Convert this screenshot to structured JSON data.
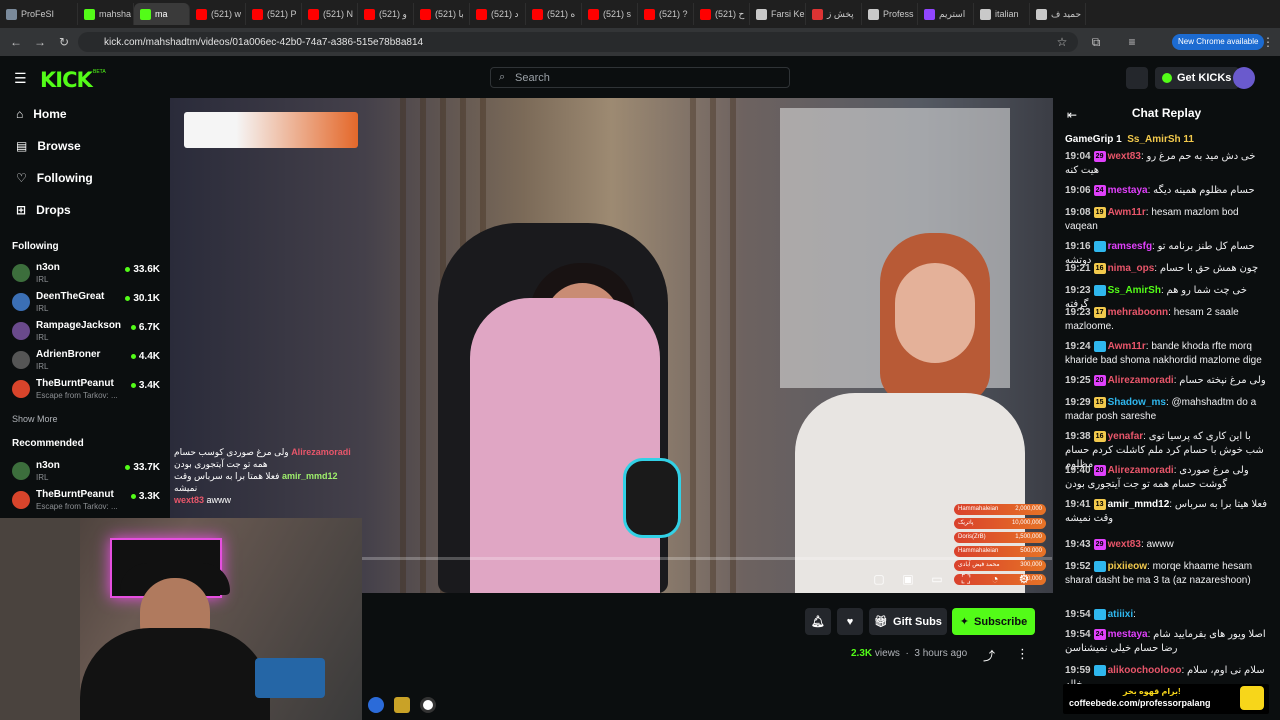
{
  "browser": {
    "tabs": [
      {
        "label": "ProFeSI",
        "color": "#7a8a9b"
      },
      {
        "label": "mahsha",
        "color": "#53fc18"
      },
      {
        "label": "ma",
        "color": "#53fc18",
        "active": true
      },
      {
        "label": "(521) w",
        "color": "#ff0000"
      },
      {
        "label": "(521) P",
        "color": "#ff0000"
      },
      {
        "label": "(521) N",
        "color": "#ff0000"
      },
      {
        "label": "(521) و",
        "color": "#ff0000"
      },
      {
        "label": "(521) با",
        "color": "#ff0000"
      },
      {
        "label": "(521) د",
        "color": "#ff0000"
      },
      {
        "label": "(521) ه",
        "color": "#ff0000"
      },
      {
        "label": "(521) s",
        "color": "#ff0000"
      },
      {
        "label": "(521) ?",
        "color": "#ff0000"
      },
      {
        "label": "(521) ح",
        "color": "#ff0000"
      },
      {
        "label": "Farsi Ke",
        "color": "#c9c9c9"
      },
      {
        "label": "پخش ز",
        "color": "#d33"
      },
      {
        "label": "Profess",
        "color": "#c9c9c9"
      },
      {
        "label": "استریم",
        "color": "#9146ff"
      },
      {
        "label": "italian",
        "color": "#c9c9c9"
      },
      {
        "label": "حمید ف",
        "color": "#c9c9c9"
      }
    ],
    "url": "kick.com/mahshadtm/videos/01a006ec-42b0-74a7-a386-515e78b8a814",
    "new_chrome": "New Chrome available"
  },
  "header": {
    "logo": "KICK",
    "logo_badge": "BETA",
    "search_placeholder": "Search",
    "get_kicks": "Get KICKs"
  },
  "sidebar": {
    "nav": [
      {
        "label": "Home",
        "icon": "home-icon"
      },
      {
        "label": "Browse",
        "icon": "browse-icon"
      },
      {
        "label": "Following",
        "icon": "heart-icon"
      },
      {
        "label": "Drops",
        "icon": "drops-icon"
      }
    ],
    "following_title": "Following",
    "following": [
      {
        "name": "n3on",
        "category": "IRL",
        "viewers": "33.6K",
        "color": "#3c6e3c"
      },
      {
        "name": "DeenTheGreat",
        "category": "IRL",
        "viewers": "30.1K",
        "color": "#3b6fb5"
      },
      {
        "name": "RampageJackson",
        "category": "IRL",
        "viewers": "6.7K",
        "color": "#6a4a8c"
      },
      {
        "name": "AdrienBroner",
        "category": "IRL",
        "viewers": "4.4K",
        "color": "#555555"
      },
      {
        "name": "TheBurntPeanut",
        "category": "Escape from Tarkov: ...",
        "viewers": "3.4K",
        "color": "#d8442b"
      }
    ],
    "show_more": "Show More",
    "recommended_title": "Recommended",
    "recommended": [
      {
        "name": "n3on",
        "category": "IRL",
        "viewers": "33.7K",
        "color": "#3c6e3c"
      },
      {
        "name": "TheBurntPeanut",
        "category": "Escape from Tarkov: ...",
        "viewers": "3.3K",
        "color": "#d8442b"
      }
    ]
  },
  "video": {
    "overlay_chat": [
      {
        "user": "Alirezamoradi",
        "text": "ولی مرغ صوردی کوسب حسام",
        "user_color": "red"
      },
      {
        "user": "",
        "text": "همه تو جت آیتجوری بودن",
        "user_color": ""
      },
      {
        "user": "amir_mmd12",
        "text": "فعلا همتا برا به سرباس وقت",
        "user_color": "green"
      },
      {
        "user": "",
        "text": "نمیشه",
        "user_color": ""
      },
      {
        "user": "wext83",
        "text": "awww",
        "user_color": "red"
      }
    ],
    "donations": [
      {
        "name": "Hammahaleian",
        "amount": "2,000,000"
      },
      {
        "name": "پاتریک",
        "amount": "10,000,000"
      },
      {
        "name": "Doris(ZrB)",
        "amount": "1,500,000"
      },
      {
        "name": "Hammahaleian",
        "amount": "500,000"
      },
      {
        "name": "محمد فیض آبادی",
        "amount": "300,000"
      },
      {
        "name": "",
        "amount": "300,000"
      }
    ]
  },
  "actions": {
    "gift_subs": "Gift Subs",
    "subscribe": "Subscribe",
    "views": "2.3K",
    "views_label": "views",
    "time_ago": "3 hours ago"
  },
  "chat": {
    "title": "Chat Replay",
    "gifters": [
      "GameGrip 1",
      "Ss_AmirSh 11"
    ],
    "messages": [
      {
        "time": "19:04",
        "badge": "29",
        "badge_color": "#e040fb",
        "user": "wext83",
        "user_color": "#e8566a",
        "text": "خی دش مید به حم مرغ رو هیت کنه"
      },
      {
        "time": "19:06",
        "badge": "24",
        "badge_color": "#e040fb",
        "user": "mestaya",
        "user_color": "#e040fb",
        "text": "حسام مظلوم همینه دیگه"
      },
      {
        "time": "19:08",
        "badge": "19",
        "badge_color": "#f2c94c",
        "user": "Awm11r",
        "user_color": "#e8566a",
        "text": "hesam mazlom bod vaqean"
      },
      {
        "time": "19:16",
        "badge": "",
        "badge_color": "",
        "user": "ramsesfg",
        "user_color": "#e040fb",
        "text": "حسام کل طنز برنامه تو دوتشه"
      },
      {
        "time": "19:21",
        "badge": "16",
        "badge_color": "#f2c94c",
        "user": "nima_ops",
        "user_color": "#e8566a",
        "text": "چون همش حق با حسام"
      },
      {
        "time": "19:23",
        "badge": "",
        "badge_color": "",
        "user": "Ss_AmirSh",
        "user_color": "#53fc18",
        "text": "خی چت شما رو هم گرفته"
      },
      {
        "time": "19:23",
        "badge": "17",
        "badge_color": "#f2c94c",
        "user": "mehraboonn",
        "user_color": "#e8566a",
        "text": "hesam 2 saale mazloome."
      },
      {
        "time": "19:24",
        "badge": "",
        "badge_color": "",
        "user": "Awm11r",
        "user_color": "#e8566a",
        "text": "bande khoda rfte morq kharide bad shoma nakhordid mazlome dige"
      },
      {
        "time": "19:25",
        "badge": "20",
        "badge_color": "#e040fb",
        "user": "Alirezamoradi",
        "user_color": "#e8566a",
        "text": "ولی مرغ نپخته حسام"
      },
      {
        "time": "19:29",
        "badge": "15",
        "badge_color": "#f2c94c",
        "user": "Shadow_ms",
        "user_color": "#2fb7ee",
        "text": "@mahshadtm do a madar posh sareshe"
      },
      {
        "time": "19:38",
        "badge": "16",
        "badge_color": "#f2c94c",
        "user": "yenafar",
        "user_color": "#e8566a",
        "text": "با این کاری که پرسیا توی شب خوش با حسام کرد ملم کاشلت کردم حسام مظلوم"
      },
      {
        "time": "19:40",
        "badge": "20",
        "badge_color": "#e040fb",
        "user": "Alirezamoradi",
        "user_color": "#e8566a",
        "text": "ولی مرغ صوردی گوشت حسام همه تو جت آیتجوری بودن"
      },
      {
        "time": "19:41",
        "badge": "13",
        "badge_color": "#f2c94c",
        "user": "amir_mmd12",
        "user_color": "#ffffff",
        "text": "فعلا هیتا برا به سرباس وقت نمیشه"
      },
      {
        "time": "19:43",
        "badge": "29",
        "badge_color": "#e040fb",
        "user": "wext83",
        "user_color": "#e8566a",
        "text": "awww"
      },
      {
        "time": "19:52",
        "badge": "",
        "badge_color": "",
        "user": "pixiieow",
        "user_color": "#f2c94c",
        "text": "morqe khaame hesam sharaf dasht be ma 3 ta (az nazareshoon)"
      },
      {
        "time": "19:54",
        "badge": "",
        "badge_color": "",
        "user": "atiiixi",
        "user_color": "#2fb7ee",
        "text": ""
      },
      {
        "time": "19:54",
        "badge": "24",
        "badge_color": "#e040fb",
        "user": "mestaya",
        "user_color": "#e040fb",
        "text": "اصلا ویور های بفرمایید شام رضا حسام خیلی نمیشناسن"
      },
      {
        "time": "19:59",
        "badge": "",
        "badge_color": "",
        "user": "alikoochoolooo",
        "user_color": "#e8566a",
        "text": "سلام نی اوم، سلام خاله"
      }
    ]
  },
  "coffee": {
    "title": "برام قهوه بخر!",
    "url": "coffeebede.com/professorpalang"
  }
}
